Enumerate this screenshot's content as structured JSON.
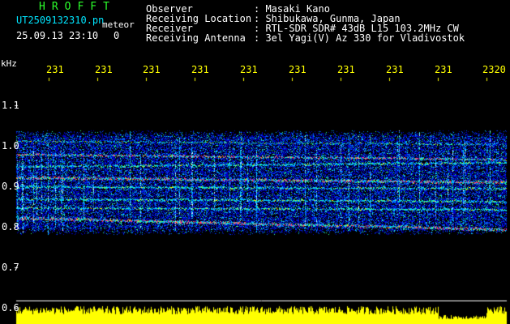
{
  "app": {
    "title": "HROFFT"
  },
  "file": {
    "name": "UT2509132310.pn",
    "type_label": "meteor",
    "datetime": "25.09.13 23:10",
    "counter": "0"
  },
  "info": {
    "rows": [
      {
        "label": "Observer",
        "value": ": Masaki Kano"
      },
      {
        "label": "Receiving Location",
        "value": ": Shibukawa, Gunma, Japan"
      },
      {
        "label": "Receiver",
        "value": ": RTL-SDR SDR# 43dB L15 103.2MHz CW"
      },
      {
        "label": "Receiving Antenna",
        "value": ": 3el Yagi(V) Az 330 for Vladivostok"
      }
    ]
  },
  "axes": {
    "y_unit": "kHz",
    "y_ticks": [
      "1.1",
      "1.0",
      "0.9",
      "0.8",
      "0.7",
      "0.6"
    ],
    "time_ticks": [
      "231",
      "231",
      "231",
      "231",
      "231",
      "231",
      "231",
      "231",
      "231",
      "2320"
    ]
  },
  "colors": {
    "background": "#000000",
    "header_green": "#2cff2c",
    "time_label": "#ffff00",
    "signal_low": "#0000c8",
    "signal_mid": "#00c8ff",
    "signal_high": "#ff3c78",
    "amplitude_bar": "#ffff00"
  }
}
